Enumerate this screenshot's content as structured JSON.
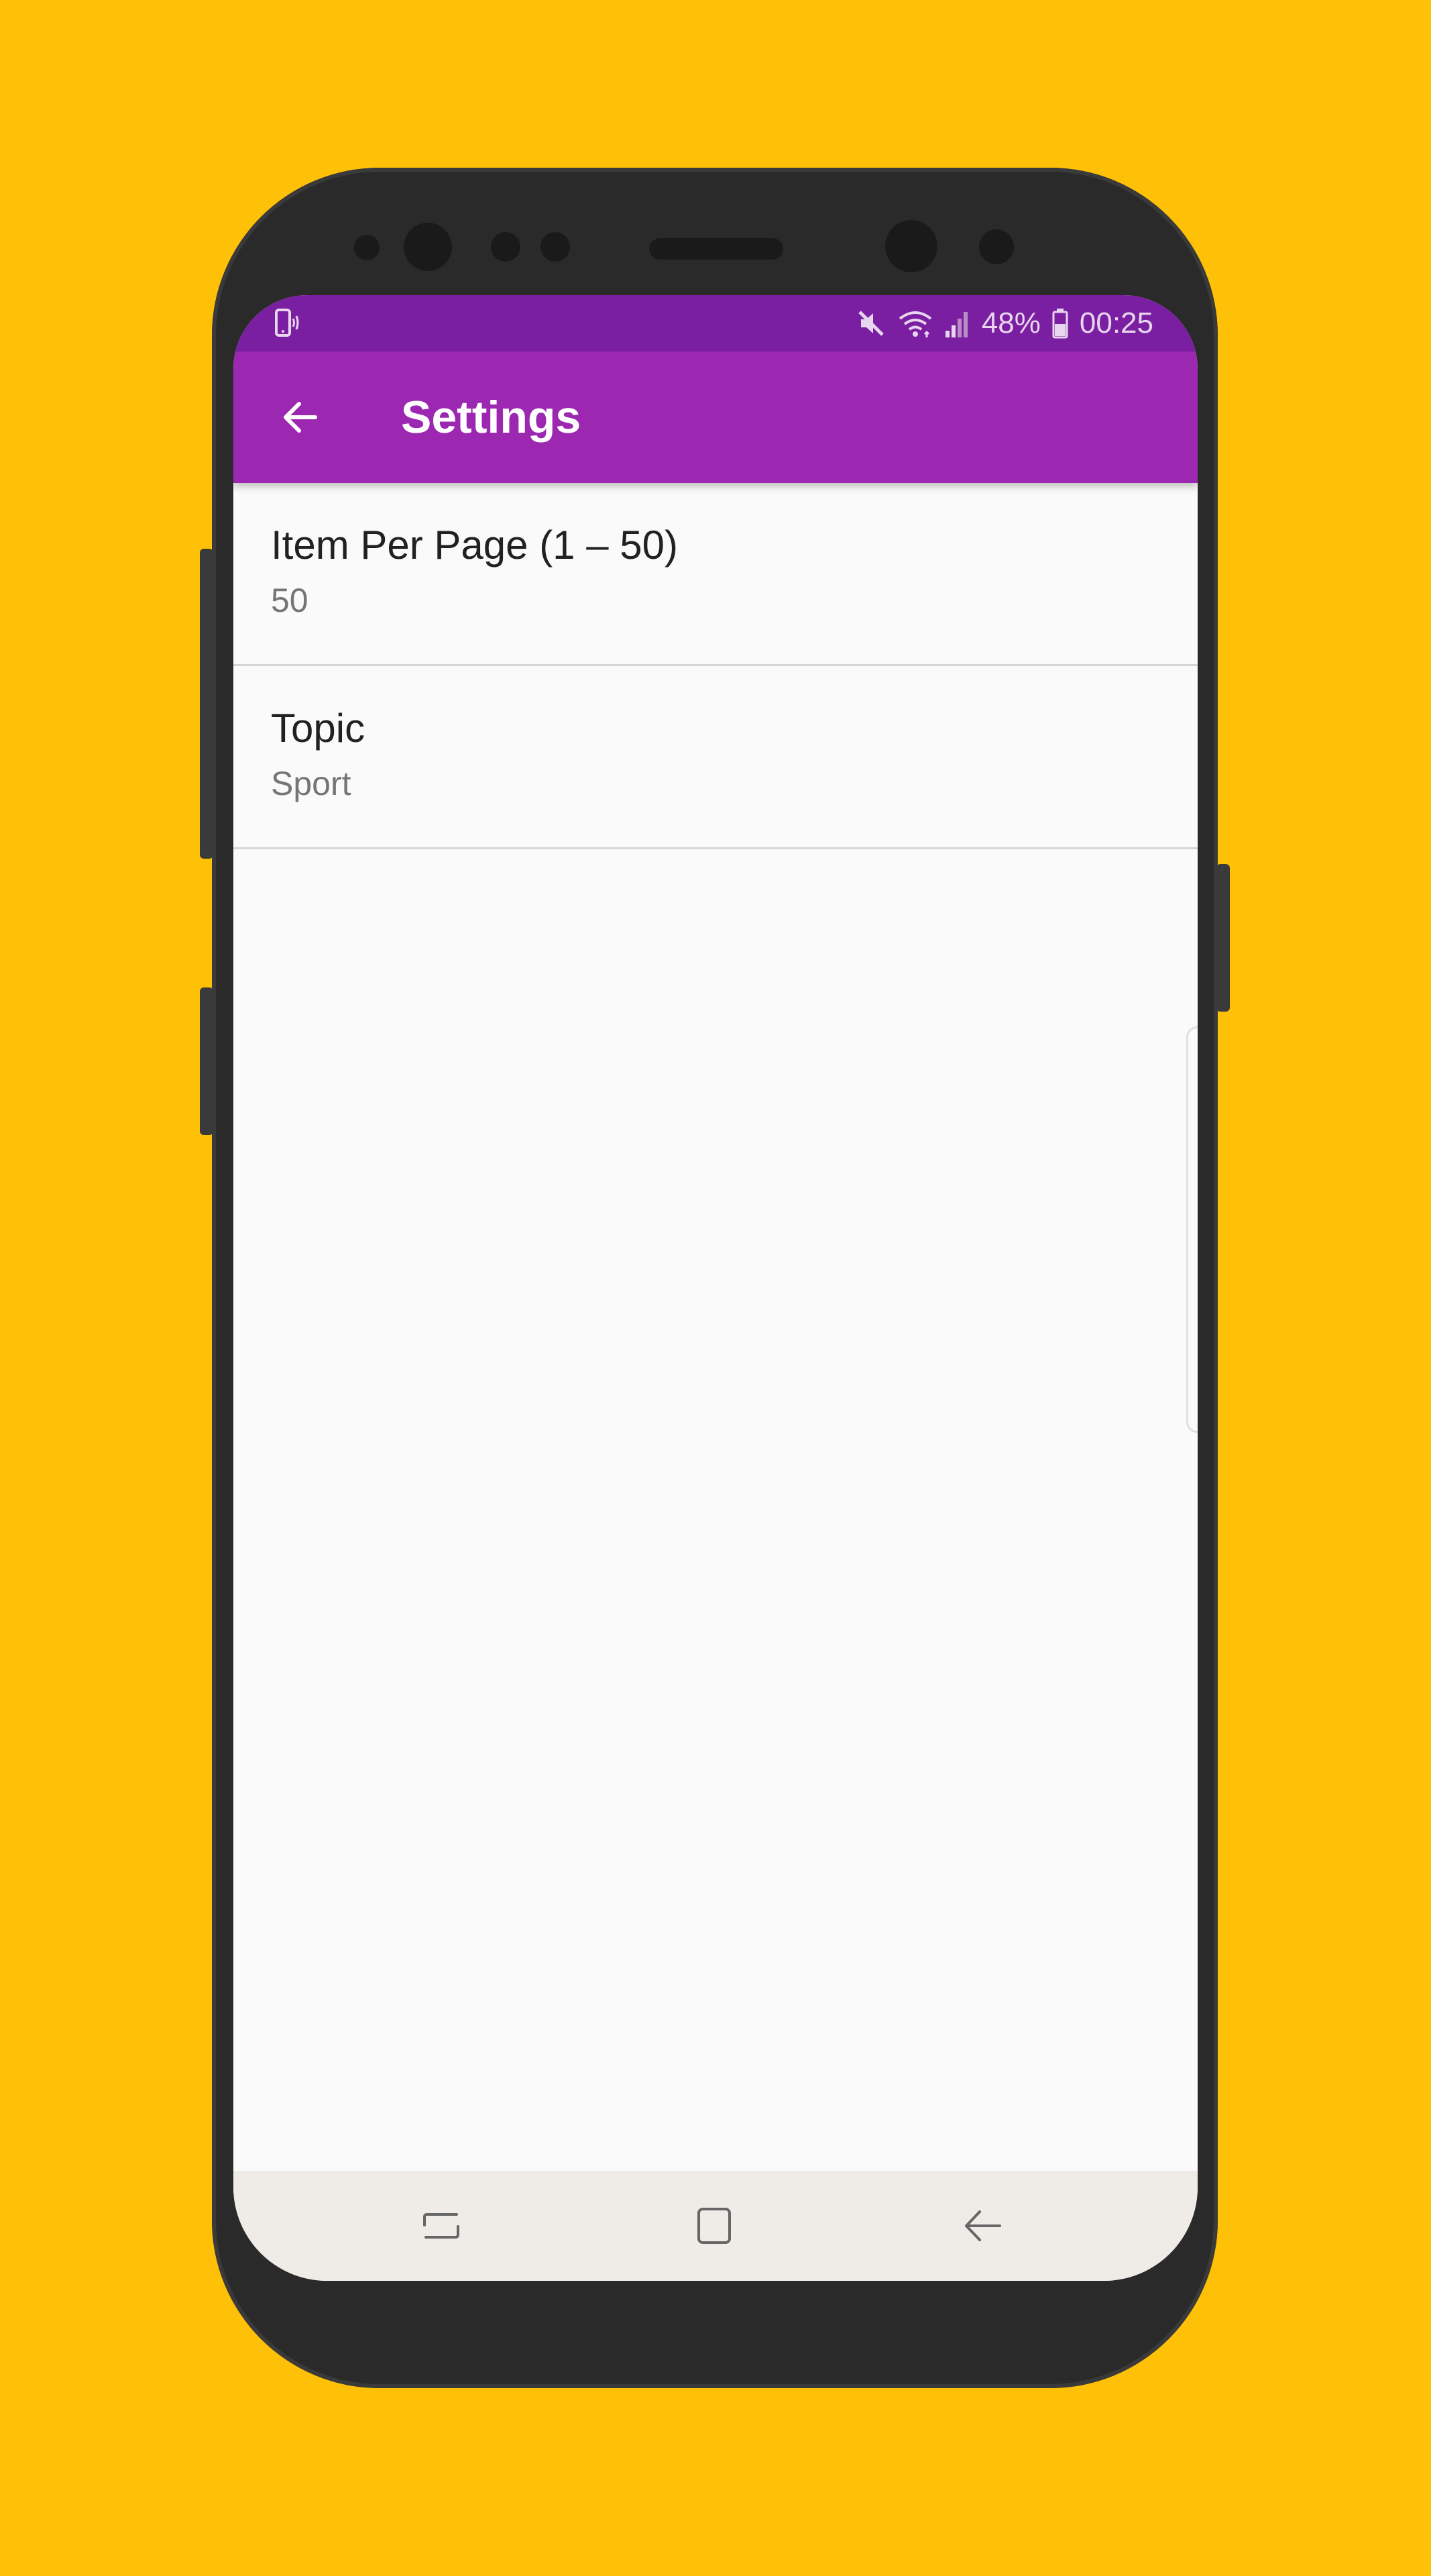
{
  "colors": {
    "background": "#FFC107",
    "status_bar": "#7B1FA2",
    "app_bar": "#9C27B0",
    "nav_bar": "#EFEBE7"
  },
  "status_bar": {
    "left_icon": "phone-vibrate-icon",
    "icons": [
      "mute-icon",
      "wifi-icon",
      "signal-icon",
      "battery-icon"
    ],
    "battery": "48%",
    "time": "00:25"
  },
  "app_bar": {
    "back_icon": "arrow-back-icon",
    "title": "Settings"
  },
  "preferences": [
    {
      "title": "Item Per Page (1 – 50)",
      "summary": "50"
    },
    {
      "title": "Topic",
      "summary": "Sport"
    }
  ],
  "nav_bar": {
    "buttons": [
      "recents-icon",
      "home-icon",
      "back-icon"
    ]
  }
}
